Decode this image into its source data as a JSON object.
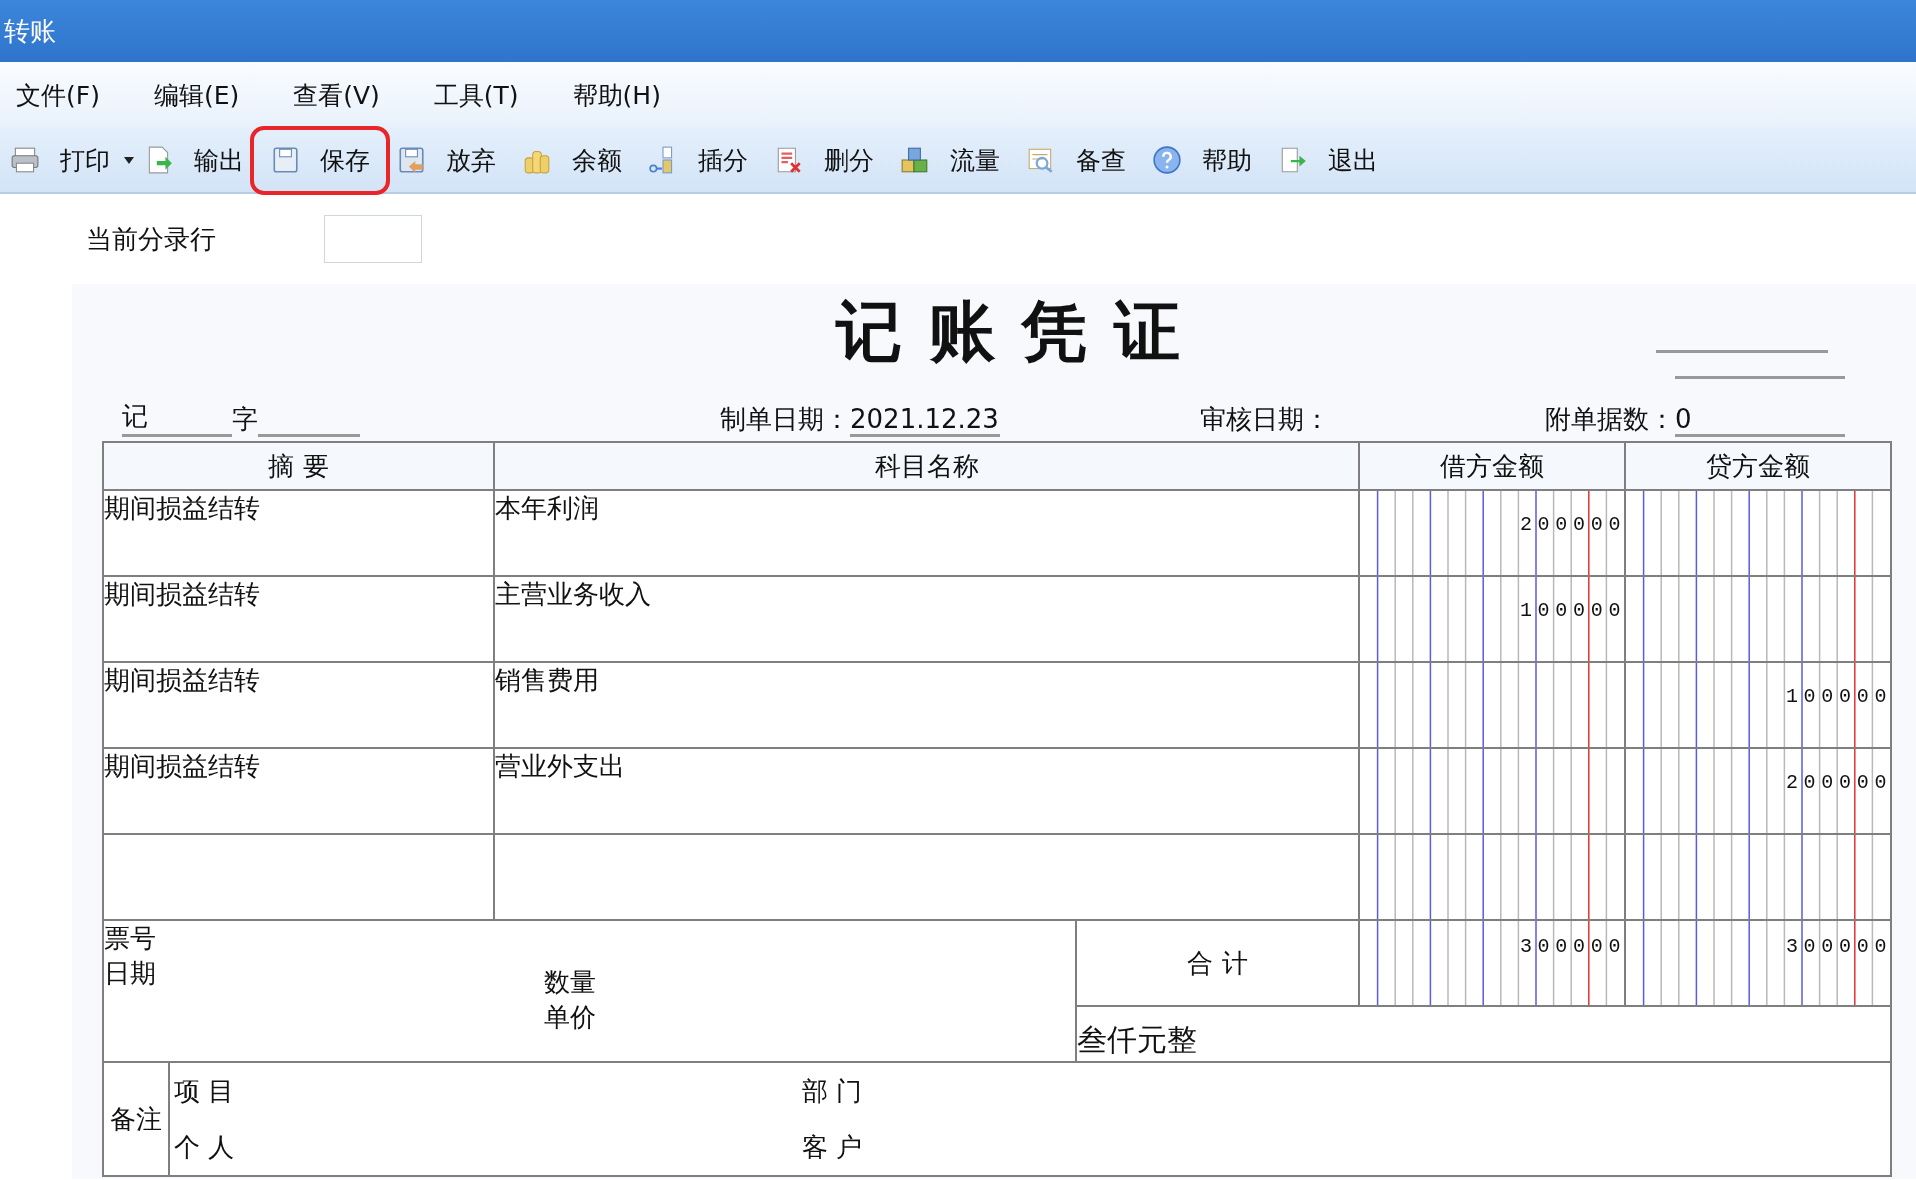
{
  "window": {
    "title": "转账"
  },
  "menu": [
    {
      "label": "文件(F)"
    },
    {
      "label": "编辑(E)"
    },
    {
      "label": "查看(V)"
    },
    {
      "label": "工具(T)"
    },
    {
      "label": "帮助(H)"
    }
  ],
  "toolbar": [
    {
      "label": "打印",
      "dropdown": true,
      "highlighted": false
    },
    {
      "label": "输出",
      "dropdown": false,
      "highlighted": false
    },
    {
      "label": "保存",
      "dropdown": false,
      "highlighted": true
    },
    {
      "label": "放弃",
      "dropdown": false,
      "highlighted": false
    },
    {
      "label": "余额",
      "dropdown": false,
      "highlighted": false
    },
    {
      "label": "插分",
      "dropdown": false,
      "highlighted": false
    },
    {
      "label": "删分",
      "dropdown": false,
      "highlighted": false
    },
    {
      "label": "流量",
      "dropdown": false,
      "highlighted": false
    },
    {
      "label": "备查",
      "dropdown": false,
      "highlighted": false
    },
    {
      "label": "帮助",
      "dropdown": false,
      "highlighted": false
    },
    {
      "label": "退出",
      "dropdown": false,
      "highlighted": false
    }
  ],
  "current_row": {
    "label": "当前分录行"
  },
  "voucher": {
    "title": "记 账 凭 证",
    "type_label": "记",
    "number_label": "字",
    "date_label": "制单日期：",
    "date": "2021.12.23",
    "audit_date_label": "审核日期：",
    "attachments_label": "附单据数：",
    "attachments": "0"
  },
  "table": {
    "columns": [
      "摘 要",
      "科目名称",
      "借方金额",
      "贷方金额"
    ],
    "rows": [
      {
        "summary": "期间损益结转",
        "account": "本年利润",
        "debit": "200000"
      },
      {
        "summary": "期间损益结转",
        "account": "主营业务收入",
        "debit": "100000"
      },
      {
        "summary": "期间损益结转",
        "account": "销售费用",
        "credit": "100000"
      },
      {
        "summary": "期间损益结转",
        "account": "营业外支出",
        "credit": "200000"
      }
    ]
  },
  "footer": {
    "ticket_label": "票号",
    "date_label": "日期",
    "quantity_label": "数量",
    "price_label": "单价",
    "total_label": "合 计",
    "debit_total": "300000",
    "credit_total": "300000",
    "amount_in_words": "叁仟元整"
  },
  "notes": {
    "label": "备注",
    "fields": [
      "项 目",
      "部 门",
      "个 人",
      "客 户"
    ]
  }
}
